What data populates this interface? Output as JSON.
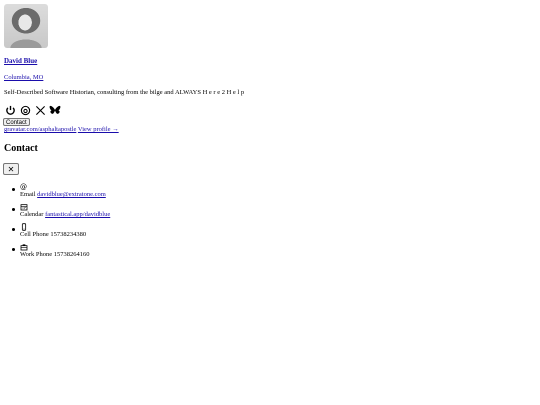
{
  "profile": {
    "name": "David Blue",
    "location": "Columbia, MO",
    "bio": "Self-Described Software Historian, consulting from the bilge and ALWAYS H e r e 2 H e l p",
    "contact_button": "Contact",
    "profile_link": "gravatar.com/asphaltapostle",
    "view_profile": "View profile →"
  },
  "contact": {
    "heading": "Contact",
    "close_label": "✕",
    "items": [
      {
        "label": "Email",
        "value": "davidblue@extratone.com",
        "icon": "at-icon"
      },
      {
        "label": "Calendar",
        "value": "fantastical.app/davidblue",
        "icon": "calendar-icon"
      },
      {
        "label": "Cell Phone",
        "value": "15738234380",
        "icon": "mobile-phone-icon"
      },
      {
        "label": "Work Phone",
        "value": "15738264160",
        "icon": "briefcase-icon"
      }
    ]
  },
  "social_icons": [
    "power-icon",
    "threads-icon",
    "x-icon",
    "bluesky-icon"
  ]
}
